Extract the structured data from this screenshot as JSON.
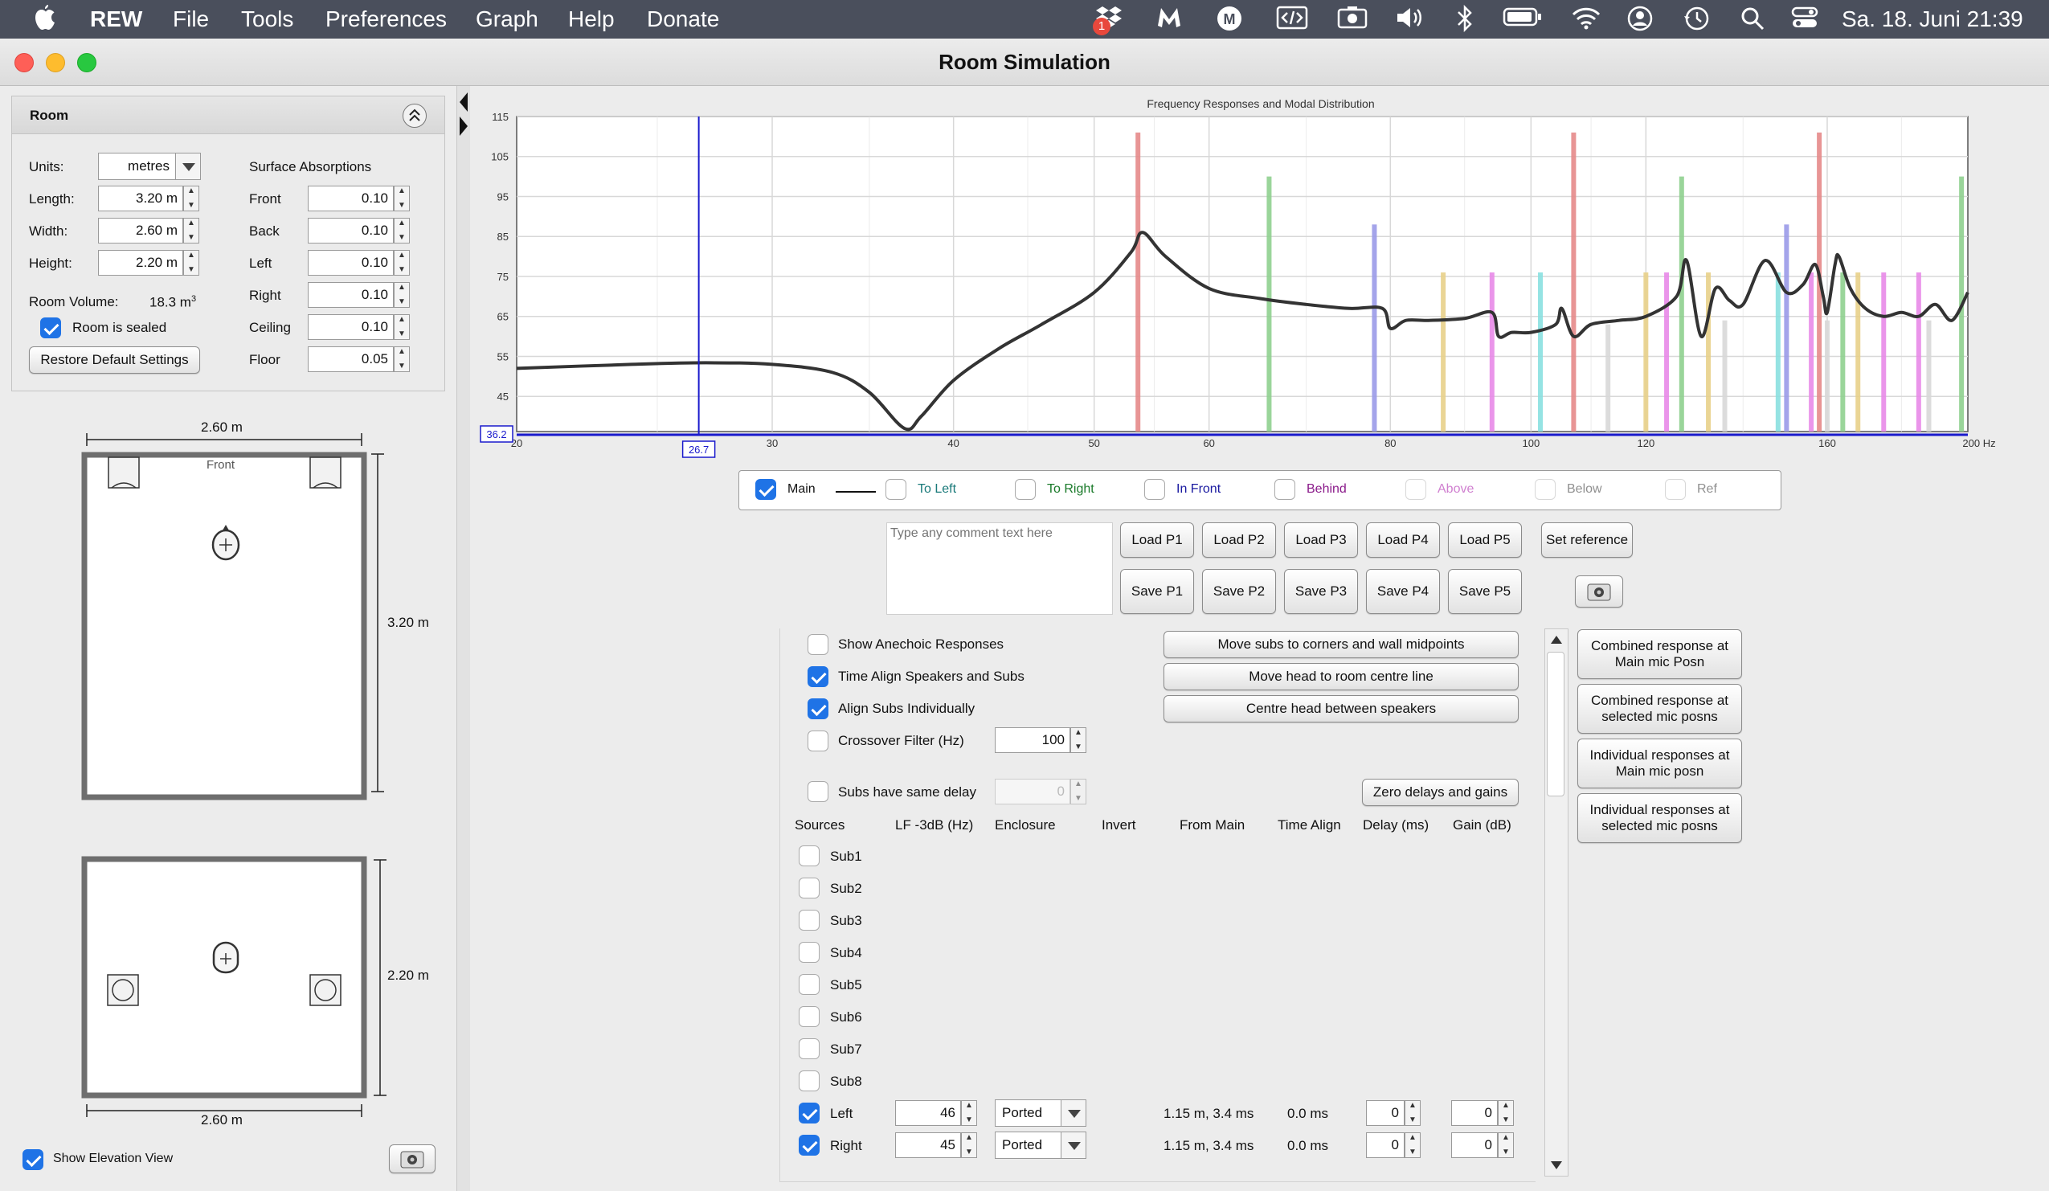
{
  "menubar": {
    "app": "REW",
    "items": [
      "File",
      "Tools",
      "Preferences",
      "Graph",
      "Help",
      "Donate"
    ],
    "badge": "1",
    "datetime": "Sa. 18. Juni  21:39"
  },
  "window": {
    "title": "Room Simulation"
  },
  "room_panel": {
    "title": "Room",
    "units_label": "Units:",
    "units_value": "metres",
    "length_label": "Length:",
    "length_value": "3.20 m",
    "width_label": "Width:",
    "width_value": "2.60 m",
    "height_label": "Height:",
    "height_value": "2.20 m",
    "volume_label": "Room Volume:",
    "volume_value": "18.3 m",
    "volume_unit_sup": "3",
    "sealed_label": "Room is sealed",
    "sealed_checked": true,
    "restore_button": "Restore Default Settings",
    "absorptions_title": "Surface Absorptions",
    "absorptions": [
      {
        "label": "Front",
        "value": "0.10"
      },
      {
        "label": "Back",
        "value": "0.10"
      },
      {
        "label": "Left",
        "value": "0.10"
      },
      {
        "label": "Right",
        "value": "0.10"
      },
      {
        "label": "Ceiling",
        "value": "0.10"
      },
      {
        "label": "Floor",
        "value": "0.05"
      }
    ]
  },
  "plan_view": {
    "top_dim": "2.60 m",
    "front_label": "Front",
    "side_dim": "3.20 m"
  },
  "elevation_view": {
    "side_dim": "2.20 m",
    "bottom_dim": "2.60 m"
  },
  "elevation_toggle": {
    "label": "Show Elevation View",
    "checked": true
  },
  "chart_data": {
    "type": "line",
    "title": "Frequency Responses and Modal Distribution",
    "xscale": "log",
    "xlim": [
      20,
      200
    ],
    "ylim": [
      36.2,
      115
    ],
    "x_ticks": [
      "20",
      "30",
      "40",
      "50",
      "60",
      "80",
      "100",
      "120",
      "160",
      "200 Hz"
    ],
    "y_ticks": [
      "115",
      "105",
      "95",
      "85",
      "75",
      "65",
      "55",
      "45"
    ],
    "cursor": {
      "x": "26.7",
      "y": "36.2"
    },
    "grid": true,
    "series": [
      {
        "name": "Main",
        "x": [
          20,
          24,
          27,
          30,
          33,
          35,
          37,
          38,
          40,
          43,
          46,
          50,
          53,
          54,
          56,
          60,
          65,
          70,
          75,
          79,
          80,
          82,
          85,
          90,
          94,
          95,
          97,
          100,
          104,
          105,
          107,
          110,
          115,
          120,
          126,
          128,
          131,
          134,
          137,
          140,
          145,
          150,
          154,
          157,
          159,
          160,
          162,
          163,
          166,
          170,
          175,
          180,
          185,
          190,
          195,
          200
        ],
        "y": [
          52,
          53,
          53.4,
          53,
          51,
          46,
          37,
          40,
          49,
          57,
          63,
          71,
          81,
          86,
          80,
          72,
          69.5,
          68,
          67,
          67,
          62,
          64,
          64,
          64.5,
          66,
          60,
          61,
          61,
          63,
          67,
          60,
          63,
          64,
          65,
          70,
          79,
          60,
          72,
          69,
          68,
          79,
          71,
          73,
          78,
          70,
          66,
          78,
          80,
          72,
          67,
          65,
          66,
          65,
          68,
          64,
          71
        ]
      }
    ],
    "modes": [
      {
        "x": 53.6,
        "top": 111,
        "color": "#e58a8a"
      },
      {
        "x": 66,
        "top": 100,
        "color": "#8fd08f"
      },
      {
        "x": 78,
        "top": 88,
        "color": "#9a9ae8"
      },
      {
        "x": 87,
        "top": 76,
        "color": "#e8d08a"
      },
      {
        "x": 94,
        "top": 76,
        "color": "#e88ae8"
      },
      {
        "x": 101.5,
        "top": 76,
        "color": "#8ae0e0"
      },
      {
        "x": 107,
        "top": 111,
        "color": "#e58a8a"
      },
      {
        "x": 113,
        "top": 63,
        "color": "#d8d8d8"
      },
      {
        "x": 120,
        "top": 76,
        "color": "#e8d08a"
      },
      {
        "x": 124,
        "top": 76,
        "color": "#e88ae8"
      },
      {
        "x": 127,
        "top": 100,
        "color": "#8fd08f"
      },
      {
        "x": 132.5,
        "top": 76,
        "color": "#e8d08a"
      },
      {
        "x": 136,
        "top": 64,
        "color": "#d8d8d8"
      },
      {
        "x": 148,
        "top": 76,
        "color": "#8ae0e0"
      },
      {
        "x": 150,
        "top": 88,
        "color": "#9a9ae8"
      },
      {
        "x": 156,
        "top": 76,
        "color": "#e88ae8"
      },
      {
        "x": 158,
        "top": 111,
        "color": "#e58a8a"
      },
      {
        "x": 160,
        "top": 64,
        "color": "#d8d8d8"
      },
      {
        "x": 164,
        "top": 76,
        "color": "#8fd08f"
      },
      {
        "x": 168,
        "top": 76,
        "color": "#e8d08a"
      },
      {
        "x": 175,
        "top": 76,
        "color": "#e88ae8"
      },
      {
        "x": 185,
        "top": 76,
        "color": "#e88ae8"
      },
      {
        "x": 188,
        "top": 64,
        "color": "#d8d8d8"
      },
      {
        "x": 198,
        "top": 100,
        "color": "#8fd08f"
      }
    ]
  },
  "legend": [
    {
      "label": "Main",
      "checked": true,
      "color": "#111111"
    },
    {
      "label": "To Left",
      "checked": false,
      "color": "#1a7a7a"
    },
    {
      "label": "To Right",
      "checked": false,
      "color": "#1a7a2a"
    },
    {
      "label": "In Front",
      "checked": false,
      "color": "#1a1aa0"
    },
    {
      "label": "Behind",
      "checked": false,
      "color": "#8a1a8a"
    },
    {
      "label": "Above",
      "checked": false,
      "color": "#d080d0"
    },
    {
      "label": "Below",
      "checked": false,
      "color": "#909090"
    },
    {
      "label": "Ref",
      "checked": false,
      "color": "#909090"
    }
  ],
  "comment": {
    "placeholder": "Type any comment text here"
  },
  "load_buttons": [
    "Load P1",
    "Load P2",
    "Load P3",
    "Load P4",
    "Load P5"
  ],
  "save_buttons": [
    "Save P1",
    "Save P2",
    "Save P3",
    "Save P4",
    "Save P5"
  ],
  "set_reference": "Set reference",
  "options": {
    "show_anechoic": {
      "label": "Show Anechoic Responses",
      "checked": false
    },
    "time_align": {
      "label": "Time Align Speakers and Subs",
      "checked": true
    },
    "align_subs": {
      "label": "Align Subs Individually",
      "checked": true
    },
    "crossover": {
      "label": "Crossover Filter (Hz)",
      "checked": false,
      "value": "100"
    },
    "subs_same_delay": {
      "label": "Subs have same delay",
      "checked": false,
      "value": "0"
    }
  },
  "action_buttons": {
    "move_subs": "Move subs to corners and wall midpoints",
    "move_head": "Move head to room centre line",
    "centre_head": "Centre head between speakers",
    "zero_delays": "Zero delays and gains"
  },
  "sources_table": {
    "headers": [
      "Sources",
      "LF -3dB (Hz)",
      "Enclosure",
      "Invert",
      "From Main",
      "Time Align",
      "Delay (ms)",
      "Gain (dB)"
    ],
    "subs": [
      "Sub1",
      "Sub2",
      "Sub3",
      "Sub4",
      "Sub5",
      "Sub6",
      "Sub7",
      "Sub8"
    ],
    "speakers": [
      {
        "name": "Left",
        "checked": true,
        "lf": "46",
        "enclosure": "Ported",
        "from_main": "1.15 m, 3.4 ms",
        "time_align": "0.0 ms",
        "delay": "0",
        "gain": "0"
      },
      {
        "name": "Right",
        "checked": true,
        "lf": "45",
        "enclosure": "Ported",
        "from_main": "1.15 m, 3.4 ms",
        "time_align": "0.0 ms",
        "delay": "0",
        "gain": "0"
      }
    ]
  },
  "response_buttons": [
    [
      "Combined response at",
      "Main mic Posn"
    ],
    [
      "Combined response at",
      "selected mic posns"
    ],
    [
      "Individual responses at",
      "Main mic posn"
    ],
    [
      "Individual responses at",
      "selected mic posns"
    ]
  ]
}
